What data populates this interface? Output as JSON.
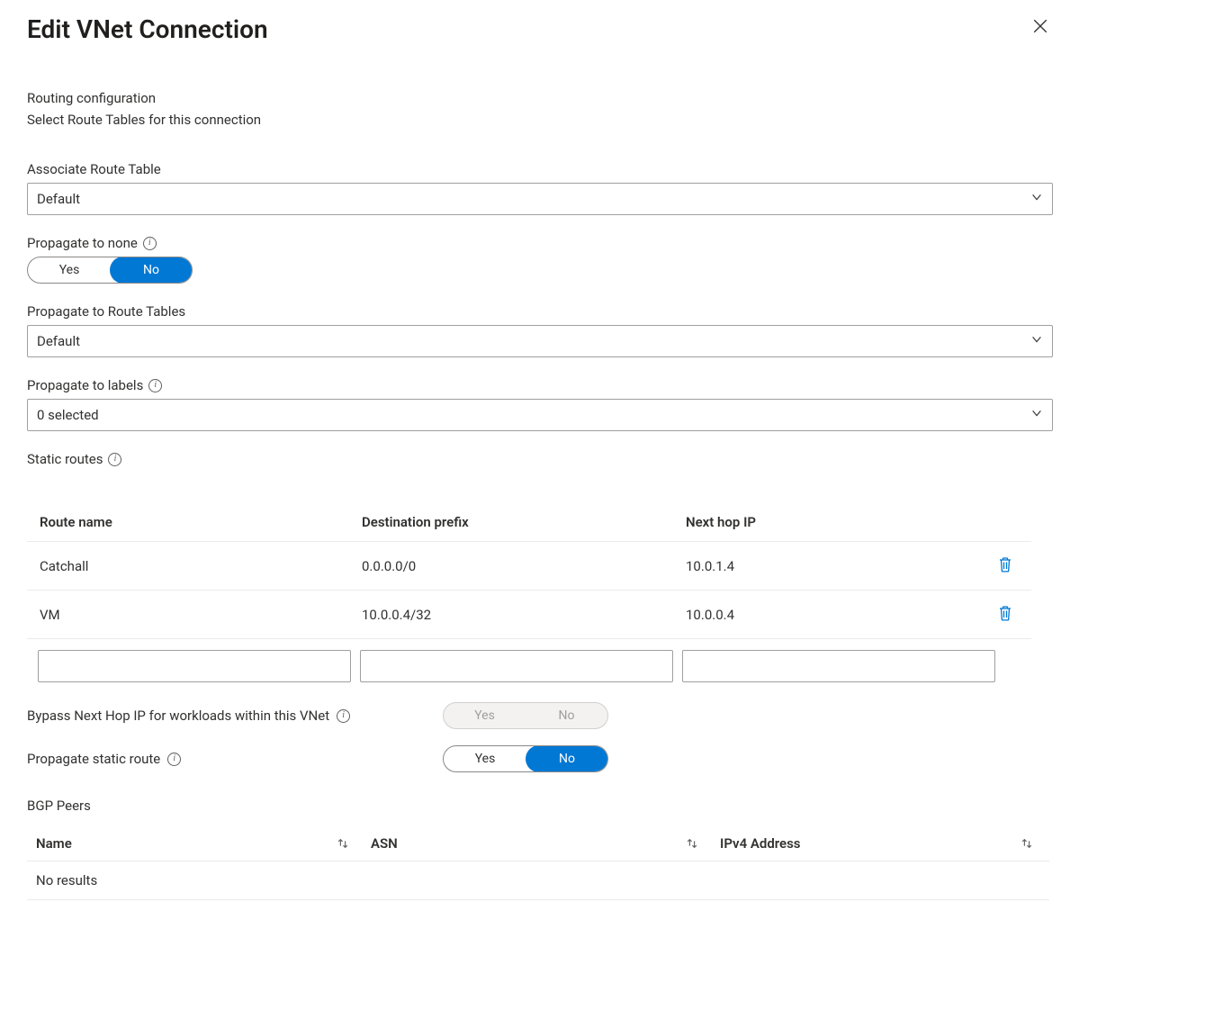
{
  "header": {
    "title": "Edit VNet Connection"
  },
  "lead": {
    "line1": "Routing configuration",
    "line2": "Select Route Tables for this connection"
  },
  "fields": {
    "associate_label": "Associate Route Table",
    "associate_value": "Default",
    "prop_none_label": "Propagate to none",
    "prop_rt_label": "Propagate to Route Tables",
    "prop_rt_value": "Default",
    "prop_labels_label": "Propagate to labels",
    "prop_labels_value": "0 selected",
    "static_routes_label": "Static routes",
    "bypass_label": "Bypass Next Hop IP for workloads within this VNet",
    "prop_static_label": "Propagate static route"
  },
  "toggles": {
    "yes": "Yes",
    "no": "No"
  },
  "routes": {
    "columns": {
      "name": "Route name",
      "dest": "Destination prefix",
      "hop": "Next hop IP"
    },
    "rows": [
      {
        "name": "Catchall",
        "dest": "0.0.0.0/0",
        "hop": "10.0.1.4"
      },
      {
        "name": "VM",
        "dest": "10.0.0.4/32",
        "hop": "10.0.0.4"
      }
    ]
  },
  "bgp": {
    "title": "BGP Peers",
    "columns": {
      "name": "Name",
      "asn": "ASN",
      "ip": "IPv4 Address"
    },
    "empty": "No results"
  }
}
